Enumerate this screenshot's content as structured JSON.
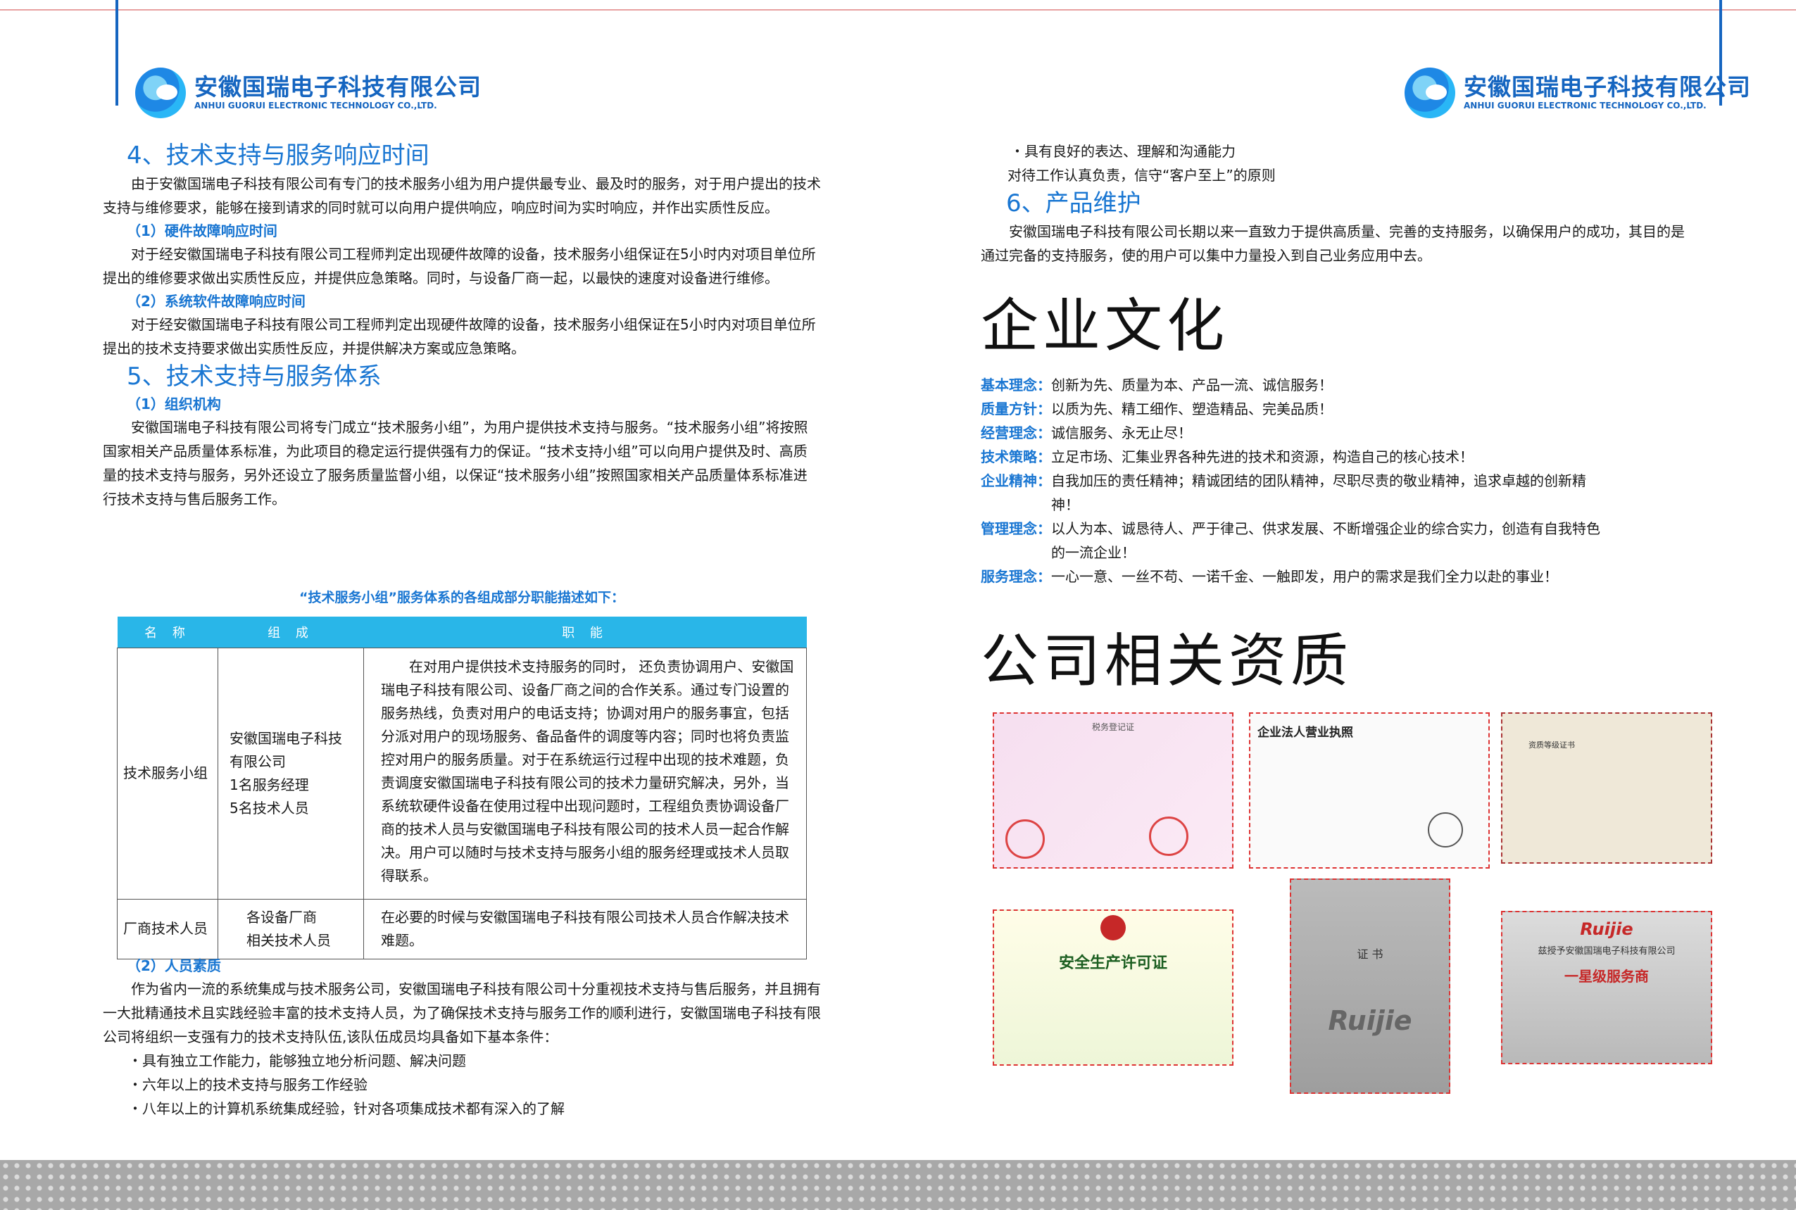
{
  "header": {
    "company_cn": "安徽国瑞电子科技有限公司",
    "company_en": "ANHUI GUORUI ELECTRONIC TECHNOLOGY CO.,LTD."
  },
  "left": {
    "s4_title": "4、技术支持与服务响应时间",
    "s4_p1": "由于安徽国瑞电子科技有限公司有专门的技术服务小组为用户提供最专业、最及时的服务，对于用户提出的技术支持与维修要求，能够在接到请求的同时就可以向用户提供响应，响应时间为实时响应，并作出实质性反应。",
    "s4_sub1": "（1）硬件故障响应时间",
    "s4_p2": "对于经安徽国瑞电子科技有限公司工程师判定出现硬件故障的设备，技术服务小组保证在5小时内对项目单位所提出的维修要求做出实质性反应，并提供应急策略。同时，与设备厂商一起，以最快的速度对设备进行维修。",
    "s4_sub2": "（2）系统软件故障响应时间",
    "s4_p3": "对于经安徽国瑞电子科技有限公司工程师判定出现硬件故障的设备，技术服务小组保证在5小时内对项目单位所提出的技术支持要求做出实质性反应，并提供解决方案或应急策略。",
    "s5_title": "5、技术支持与服务体系",
    "s5_sub1": "（1）组织机构",
    "s5_p1": "安徽国瑞电子科技有限公司将专门成立“技术服务小组”，为用户提供技术支持与服务。“技术服务小组”将按照国家相关产品质量体系标准，为此项目的稳定运行提供强有力的保证。“技术支持小组”可以向用户提供及时、高质量的技术支持与服务，另外还设立了服务质量监督小组，以保证“技术服务小组”按照国家相关产品质量体系标准进行技术支持与售后服务工作。",
    "table_caption": "“技术服务小组”服务体系的各组成部分职能描述如下：",
    "table_headers": [
      "名 称",
      "组 成",
      "职 能"
    ],
    "table_rows": [
      {
        "name": "技术服务小组",
        "members": [
          "安徽国瑞电子科技",
          "有限公司",
          "1名服务经理",
          "5名技术人员"
        ],
        "duty": "在对用户提供技术支持服务的同时， 还负责协调用户、安徽国瑞电子科技有限公司、设备厂商之间的合作关系。通过专门设置的服务热线，负责对用户的电话支持；协调对用户的服务事宜，包括分派对用户的现场服务、备品备件的调度等内容；同时也将负责监控对用户的服务质量。对于在系统运行过程中出现的技术难题，负责调度安徽国瑞电子科技有限公司的技术力量研究解决，另外，当系统软硬件设备在使用过程中出现问题时，工程组负责协调设备厂商的技术人员与安徽国瑞电子科技有限公司的技术人员一起合作解决。用户可以随时与技术支持与服务小组的服务经理或技术人员取得联系。"
      },
      {
        "name": "厂商技术人员",
        "members": [
          "各设备厂商",
          "相关技术人员"
        ],
        "duty": "在必要的时候与安徽国瑞电子科技有限公司技术人员合作解决技术难题。"
      }
    ],
    "s5_sub2": "（2）人员素质",
    "s5_p2": "作为省内一流的系统集成与技术服务公司，安徽国瑞电子科技有限公司十分重视技术支持与售后服务，并且拥有一大批精通技术且实践经验丰富的技术支持人员，为了确保技术支持与服务工作的顺利进行，安徽国瑞电子科技有限公司将组织一支强有力的技术支持队伍,该队伍成员均具备如下基本条件：",
    "bullets": [
      "・具有独立工作能力，能够独立地分析问题、解决问题",
      "・六年以上的技术支持与服务工作经验",
      "・八年以上的计算机系统集成经验，针对各项集成技术都有深入的了解"
    ]
  },
  "right": {
    "bullet4": "・具有良好的表达、理解和沟通能力",
    "bullet5": "对待工作认真负责，信守“客户至上”的原则",
    "s6_title": "6、产品维护",
    "s6_p": "安徽国瑞电子科技有限公司长期以来一直致力于提供高质量、完善的支持服务，以确保用户的成功，其目的是通过完备的支持服务，使的用户可以集中力量投入到自己业务应用中去。",
    "culture_title": "企业文化",
    "culture": [
      {
        "label": "基本理念：",
        "text": "创新为先、质量为本、产品一流、诚信服务！"
      },
      {
        "label": "质量方针：",
        "text": "以质为先、精工细作、塑造精品、完美品质！"
      },
      {
        "label": "经营理念：",
        "text": "诚信服务、永无止尽！"
      },
      {
        "label": "技术策略：",
        "text": "立足市场、汇集业界各种先进的技术和资源，构造自己的核心技术！"
      },
      {
        "label": "企业精神：",
        "text": "自我加压的责任精神；精诚团结的团队精神，尽职尽责的敬业精神，追求卓越的创新精神！"
      },
      {
        "label": "管理理念：",
        "text": "以人为本、诚恳待人、严于律己、供求发展、不断增强企业的综合实力，创造有自我特色的一流企业！"
      },
      {
        "label": "服务理念：",
        "text": "一心一意、一丝不苟、一诺千金、一触即发，用户的需求是我们全力以赴的事业！"
      }
    ],
    "qual_title": "公司相关资质",
    "certs": {
      "c1": "税务登记证",
      "c2": "企业法人营业执照",
      "c3": "资质等级证书",
      "c4": "安全生产许可证",
      "c5a": "证 书",
      "c5b": "Ruijie",
      "c6a": "Ruijie",
      "c6b": "兹授予安徽国瑞电子科技有限公司",
      "c6c": "一星级服务商"
    }
  },
  "colors": {
    "accent": "#1976d2",
    "table_header": "#29b6e8",
    "cert_border": "#dd3333"
  }
}
